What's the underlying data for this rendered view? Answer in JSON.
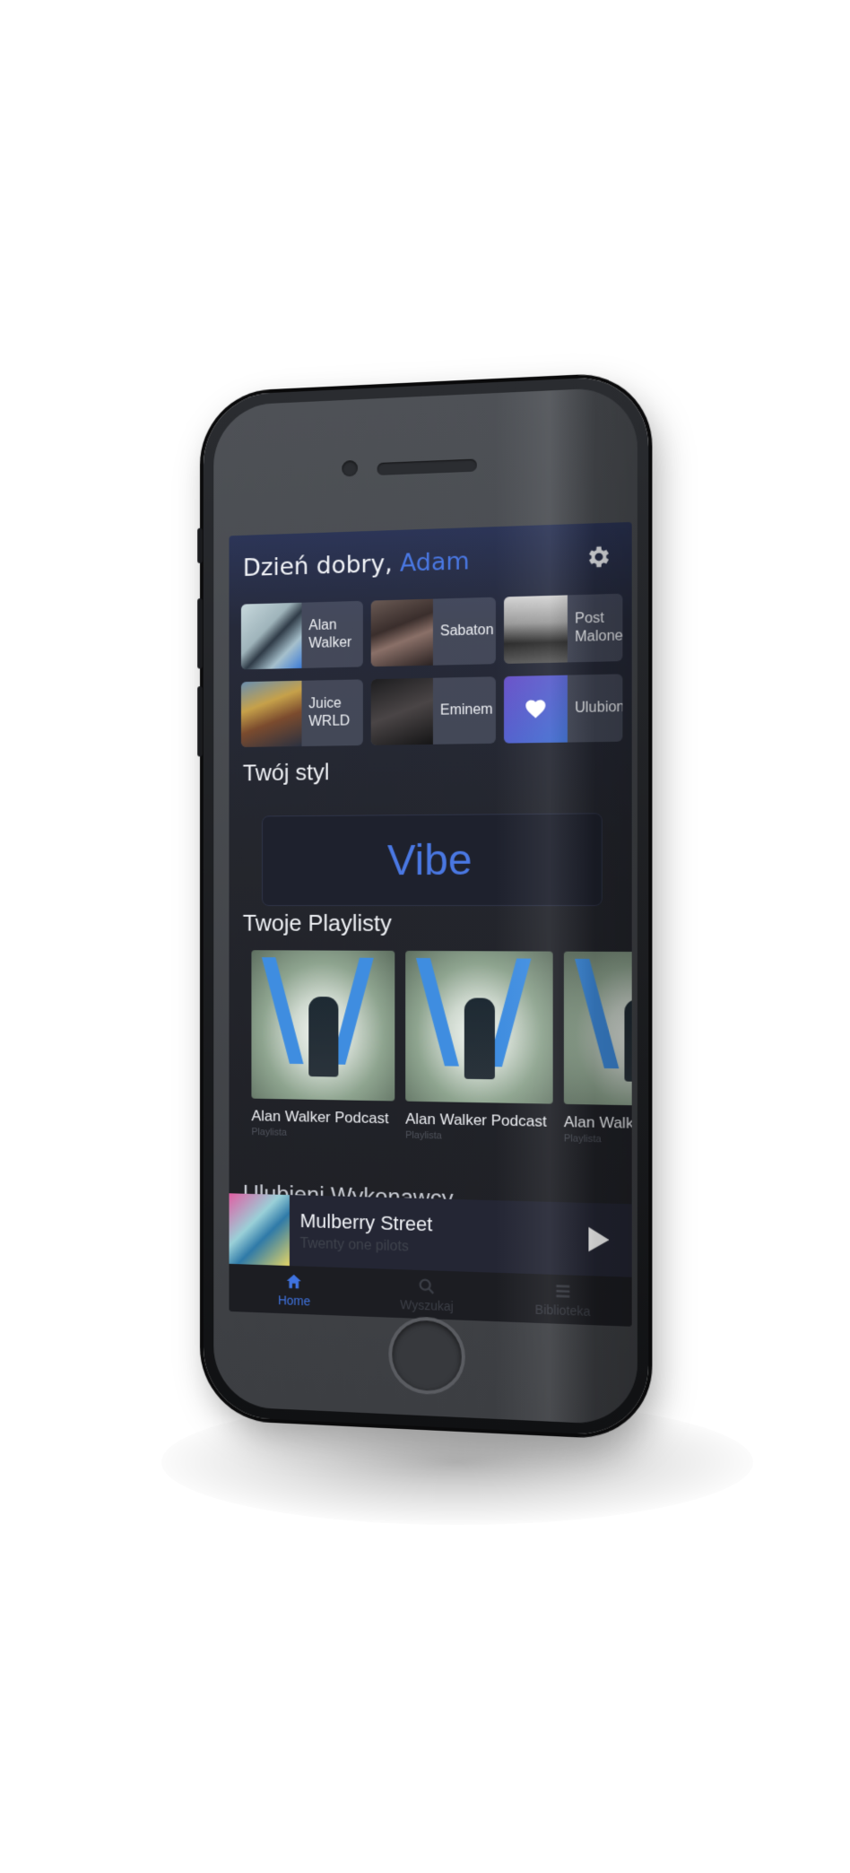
{
  "app": {
    "greeting_prefix": "Dzień dobry,",
    "user_name": "Adam"
  },
  "shortcuts": [
    {
      "label": "Alan Walker",
      "image": "alan-walker-portrait"
    },
    {
      "label": "Sabaton",
      "image": "sabaton-band-photo"
    },
    {
      "label": "Post Malone",
      "image": "post-malone-portrait"
    },
    {
      "label": "Juice WRLD",
      "image": "juice-wrld-portrait"
    },
    {
      "label": "Eminem",
      "image": "eminem-portrait"
    },
    {
      "label": "Ulubione",
      "image": "heart-icon"
    }
  ],
  "sections": {
    "style_title": "Twój styl",
    "vibe_label": "Vibe",
    "playlists_title": "Twoje Playlisty",
    "artists_title_partial": "Ulubieni Wykonawcy"
  },
  "playlists": [
    {
      "title": "Alan Walker Podcast",
      "subtitle": "Playlista"
    },
    {
      "title": "Alan Walker Podcast",
      "subtitle": "Playlista"
    },
    {
      "title": "Alan Walker Podcast",
      "subtitle": "Playlista"
    }
  ],
  "now_playing": {
    "title": "Mulberry Street",
    "artist": "Twenty one pilots",
    "control_icon": "play-icon"
  },
  "tabs": [
    {
      "label": "Home",
      "icon": "home-icon",
      "active": true
    },
    {
      "label": "Wyszukaj",
      "icon": "search-icon",
      "active": false
    },
    {
      "label": "Biblioteka",
      "icon": "library-icon",
      "active": false
    }
  ],
  "colors": {
    "accent": "#4a78e3",
    "background": "#1e1f24",
    "text": "#eef0f4",
    "inactive_tab": "#3c3f47"
  }
}
